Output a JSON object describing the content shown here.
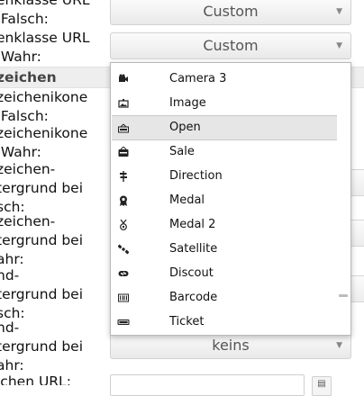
{
  "labels": [
    "enklasse URL\n Falsch:",
    "enklasse URL\n Wahr:",
    "zeichenikone\n Falsch:",
    "zeichenikone\n Wahr:",
    "zeichen-\ntergrund bei\nsch:",
    "zeichen-\ntergrund bei\nahr:",
    "nd-\ntergrund bei\nsch:",
    "nd-\ntergrund bei\nahr:",
    "ichen URL:"
  ],
  "section_title": "zeichen",
  "selects": {
    "url_false": "Custom",
    "url_true": "Custom",
    "bottom": "keins"
  },
  "dropdown": {
    "options": [
      {
        "label": "Camera 3",
        "icon": "camera-icon"
      },
      {
        "label": "Image",
        "icon": "image-icon"
      },
      {
        "label": "Open",
        "icon": "open-sign-icon",
        "selected": true
      },
      {
        "label": "Sale",
        "icon": "sale-tag-icon"
      },
      {
        "label": "Direction",
        "icon": "direction-signpost-icon"
      },
      {
        "label": "Medal",
        "icon": "medal-icon"
      },
      {
        "label": "Medal 2",
        "icon": "medal-2-icon"
      },
      {
        "label": "Satellite",
        "icon": "satellite-icon"
      },
      {
        "label": "Discout",
        "icon": "discount-icon"
      },
      {
        "label": "Barcode",
        "icon": "barcode-icon"
      },
      {
        "label": "Ticket",
        "icon": "ticket-icon"
      }
    ]
  }
}
